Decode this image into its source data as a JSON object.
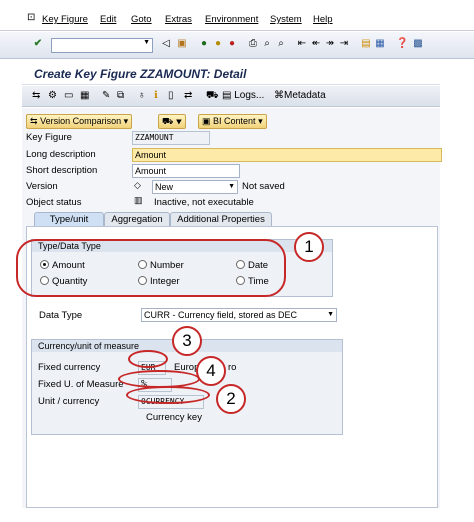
{
  "menu": [
    "Key Figure",
    "Edit",
    "Goto",
    "Extras",
    "Environment",
    "System",
    "Help"
  ],
  "title": "Create Key Figure ZZAMOUNT: Detail",
  "app_toolbar": {
    "logs": "Logs...",
    "metadata": "Metadata"
  },
  "buttons": {
    "version_comparison": "Version Comparison",
    "bi_content": "BI Content"
  },
  "fields": {
    "key_figure_label": "Key Figure",
    "key_figure_value": "ZZAMOUNT",
    "long_desc_label": "Long description",
    "long_desc_value": "Amount",
    "short_desc_label": "Short description",
    "short_desc_value": "Amount",
    "version_label": "Version",
    "version_value": "New",
    "version_status": "Not saved",
    "object_status_label": "Object status",
    "object_status_value": "Inactive, not executable"
  },
  "tabs": [
    "Type/unit",
    "Aggregation",
    "Additional Properties"
  ],
  "type_group": {
    "header": "Type/Data Type",
    "options": [
      "Amount",
      "Number",
      "Date",
      "Quantity",
      "Integer",
      "Time"
    ],
    "selected": "Amount",
    "data_type_label": "Data Type",
    "data_type_value": "CURR - Currency field, stored as DEC"
  },
  "currency_group": {
    "header": "Currency/unit of measure",
    "fixed_currency_label": "Fixed currency",
    "fixed_currency_value": "EUR",
    "fixed_currency_text": "Europ",
    "fixed_currency_text_tail": "ro",
    "fixed_uom_label": "Fixed U. of Measure",
    "fixed_uom_value": "%",
    "unit_currency_label": "Unit / currency",
    "unit_currency_value": "0CURRENCY",
    "unit_currency_text": "Currency key"
  },
  "callouts": [
    "1",
    "2",
    "3",
    "4"
  ],
  "accent": "#c62828"
}
